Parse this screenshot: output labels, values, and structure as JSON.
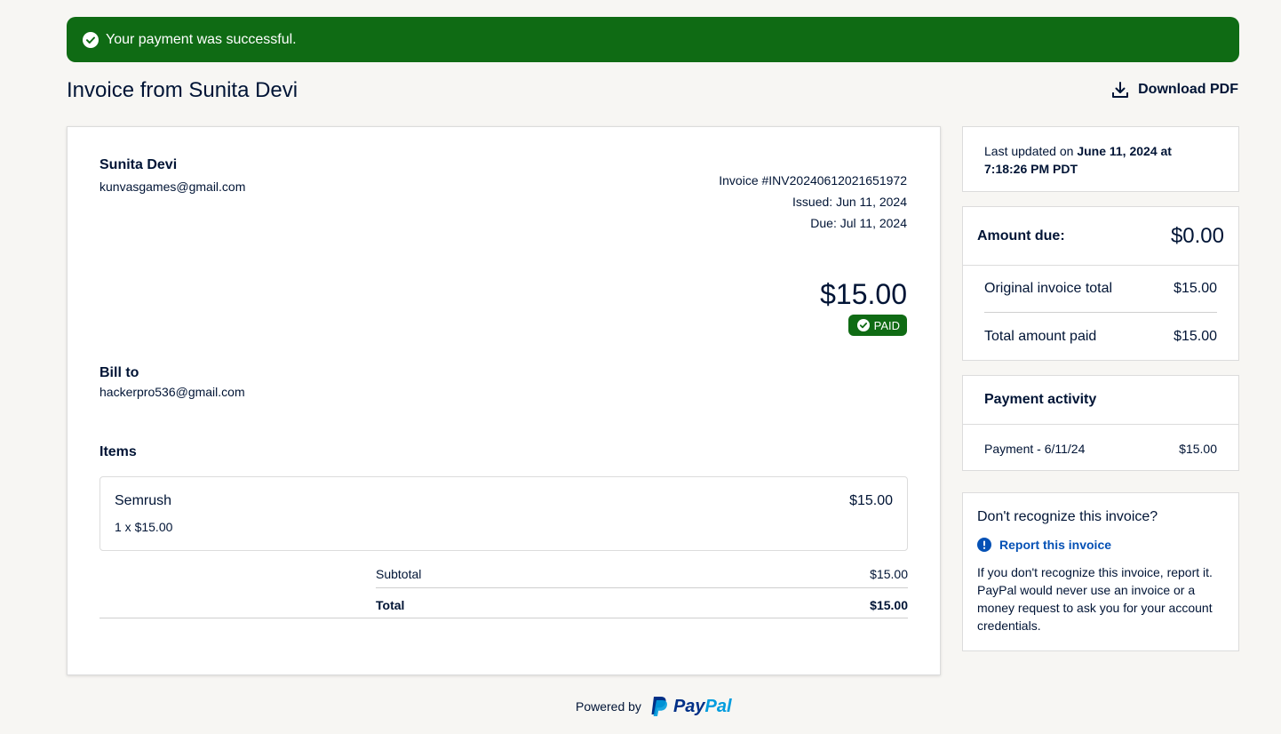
{
  "banner": {
    "message": "Your payment was successful."
  },
  "header": {
    "title": "Invoice from Sunita Devi",
    "download_label": "Download PDF"
  },
  "invoice": {
    "sender_name": "Sunita Devi",
    "sender_email": "kunvasgames@gmail.com",
    "number": "Invoice #INV20240612021651972",
    "issued": "Issued: Jun 11, 2024",
    "due": "Due: Jul 11, 2024",
    "amount": "$15.00",
    "status": "PAID",
    "bill_to_label": "Bill to",
    "bill_to_email": "hackerpro536@gmail.com",
    "items_label": "Items",
    "items": [
      {
        "name": "Semrush",
        "price": "$15.00",
        "qty": "1 x $15.00"
      }
    ],
    "subtotal_label": "Subtotal",
    "subtotal": "$15.00",
    "total_label": "Total",
    "total": "$15.00"
  },
  "sidebar": {
    "last_updated_prefix": "Last updated on ",
    "last_updated_value": "June 11, 2024 at 7:18:26 PM PDT",
    "amount_due_label": "Amount due:",
    "amount_due": "$0.00",
    "original_total_label": "Original invoice total",
    "original_total": "$15.00",
    "total_paid_label": "Total amount paid",
    "total_paid": "$15.00",
    "activity_title": "Payment activity",
    "activity": [
      {
        "label": "Payment - 6/11/24",
        "amount": "$15.00"
      }
    ],
    "report_title": "Don't recognize this invoice?",
    "report_link": "Report this invoice",
    "report_text": "If you don't recognize this invoice, report it. PayPal would never use an invoice or a money request to ask you for your account credentials."
  },
  "footer": {
    "powered_by": "Powered by",
    "brand": "PayPal"
  },
  "colors": {
    "success": "#0f6b14",
    "text": "#001435",
    "link": "#0551b5",
    "background": "#f7f6f3"
  }
}
